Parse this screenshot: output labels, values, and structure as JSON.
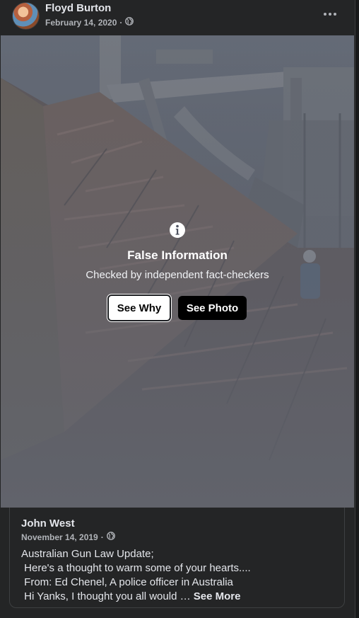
{
  "post": {
    "author": "Floyd Burton",
    "date": "February 14, 2020",
    "separator": "·",
    "privacy_icon": "globe-icon",
    "menu_icon": "more-options-icon"
  },
  "fact_check": {
    "icon": "info-icon",
    "title": "False Information",
    "subtitle": "Checked by independent fact-checkers",
    "see_why_label": "See Why",
    "see_photo_label": "See Photo"
  },
  "shared_post": {
    "author": "John West",
    "date": "November 14, 2019",
    "separator": "·",
    "privacy_icon": "globe-icon",
    "lines": [
      "Australian Gun Law Update;",
      " Here's a thought to warm some of your hearts....",
      " From: Ed Chenel, A police officer in Australia",
      " Hi Yanks, I thought you all would … "
    ],
    "see_more_label": "See More"
  },
  "colors": {
    "background": "#242526",
    "text_primary": "#e4e6eb",
    "text_secondary": "#b0b3b8"
  }
}
